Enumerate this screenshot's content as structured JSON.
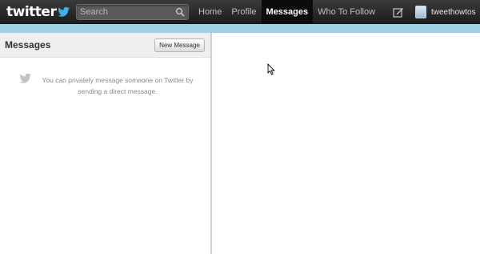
{
  "topbar": {
    "logo_text": "twitter",
    "search_placeholder": "Search",
    "nav": [
      {
        "label": "Home",
        "active": false
      },
      {
        "label": "Profile",
        "active": false
      },
      {
        "label": "Messages",
        "active": true
      },
      {
        "label": "Who To Follow",
        "active": false
      }
    ],
    "username": "tweethowtos",
    "compose_icon": "compose-icon"
  },
  "colors": {
    "topbar_bg": "#262626",
    "strip": "#9fd0e6",
    "panel_header": "#efefef",
    "empty_text": "#8a8a8a"
  },
  "left_panel": {
    "title": "Messages",
    "new_message_label": "New Message",
    "empty_text": "You can privately message someone on Twitter by sending a direct message."
  }
}
